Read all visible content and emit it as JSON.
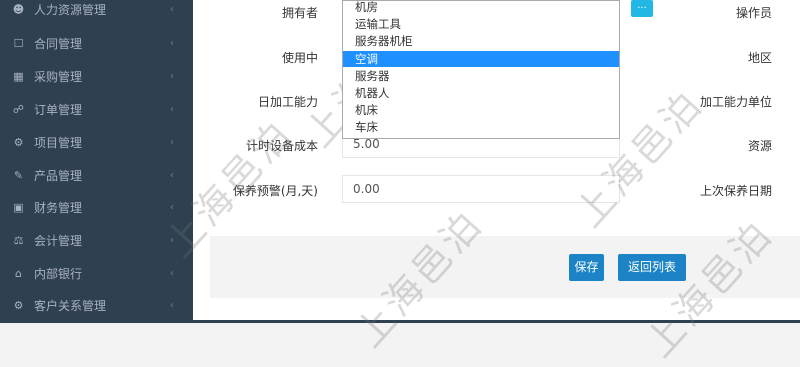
{
  "sidebar": {
    "items": [
      {
        "icon": "users-icon",
        "glyph": "👥",
        "label": "人力资源管理"
      },
      {
        "icon": "contract-icon",
        "glyph": "☐",
        "label": "合同管理"
      },
      {
        "icon": "purchase-icon",
        "glyph": "▦",
        "label": "采购管理"
      },
      {
        "icon": "cart-icon",
        "glyph": "🛒",
        "label": "订单管理"
      },
      {
        "icon": "project-icon",
        "glyph": "⚙",
        "label": "项目管理"
      },
      {
        "icon": "edit-icon",
        "glyph": "✎",
        "label": "产品管理"
      },
      {
        "icon": "finance-icon",
        "glyph": "▭",
        "label": "财务管理"
      },
      {
        "icon": "scale-icon",
        "glyph": "⚖",
        "label": "会计管理"
      },
      {
        "icon": "bank-icon",
        "glyph": "🏛",
        "label": "内部银行"
      },
      {
        "icon": "crm-icon",
        "glyph": "⚙",
        "label": "客户关系管理"
      }
    ],
    "chevron": "‹"
  },
  "form": {
    "owner_label": "拥有者",
    "operator_label": "操作员",
    "in_use_label": "使用中",
    "region_label": "地区",
    "daily_capacity_label": "日加工能力",
    "capacity_unit_label": "加工能力单位",
    "timed_cost_label": "计时设备成本",
    "timed_cost_value": "5.00",
    "resource_label": "资源",
    "maintenance_warning_label": "保养预警(月,天)",
    "maintenance_warning_value": "0.00",
    "last_maintenance_label": "上次保养日期",
    "lookup_button": "..."
  },
  "dropdown": {
    "options": [
      "机房",
      "运输工具",
      "服务器机柜",
      "空调",
      "服务器",
      "机器人",
      "机床",
      "车床"
    ],
    "selected": "空调"
  },
  "actions": {
    "save": "保存",
    "back_to_list": "返回列表"
  },
  "watermark": "上海邑泊"
}
